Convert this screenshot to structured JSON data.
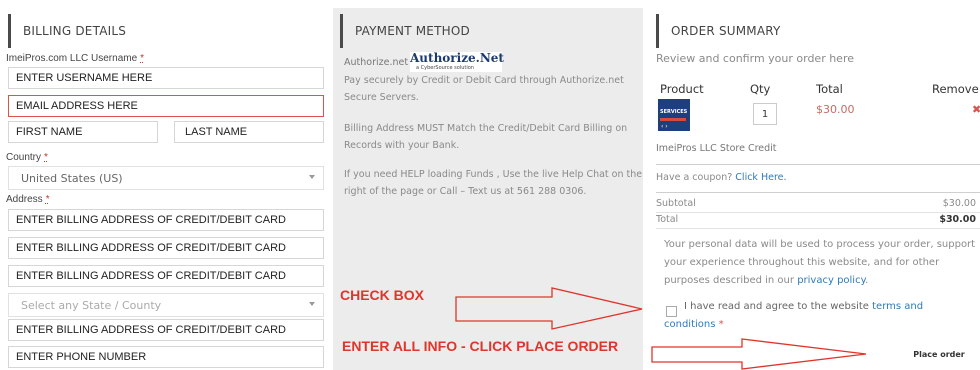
{
  "billing": {
    "header": "BILLING DETAILS",
    "username_label": "ImeiPros.com LLC Username",
    "required_mark": "*",
    "username_value": "ENTER USERNAME HERE",
    "email_value": "EMAIL ADDRESS HERE",
    "first_name_value": "FIRST NAME",
    "last_name_value": "LAST NAME",
    "country_label": "Country",
    "country_value": "United States (US)",
    "address_label": "Address",
    "address_line1": "ENTER BILLING ADDRESS OF CREDIT/DEBIT CARD",
    "address_line2": "ENTER BILLING ADDRESS OF CREDIT/DEBIT CARD",
    "city_value": "ENTER BILLING ADDRESS OF CREDIT/DEBIT CARD",
    "state_placeholder": "Select any State / County",
    "zip_value": "ENTER BILLING ADDRESS OF CREDIT/DEBIT CARD",
    "phone_value": "ENTER PHONE NUMBER"
  },
  "payment": {
    "header": "PAYMENT METHOD",
    "method_name": "Authorize.net",
    "logo_text": "Authorize.Net",
    "logo_sub": "a CyberSource solution",
    "desc1": "Pay securely by Credit or Debit Card through Authorize.net Secure Servers.",
    "desc2": "Billing Address MUST Match the Credit/Debit Card Billing on Records with your Bank.",
    "desc3": "If you need HELP loading Funds , Use the live Help Chat on the right of the page or Call – Text us at 561 288 0306."
  },
  "annotations": {
    "check_box": "CHECK BOX",
    "enter_info": "ENTER ALL INFO - CLICK PLACE ORDER",
    "arrow_color": "#e0352b"
  },
  "summary": {
    "header": "ORDER SUMMARY",
    "subtitle": "Review and confirm your order here",
    "col_product": "Product",
    "col_qty": "Qty",
    "col_total": "Total",
    "col_remove": "Remove",
    "item_thumb_text": "SERVICES",
    "item_qty": "1",
    "item_price": "$30.00",
    "item_name": "ImeiPros LLC Store Credit",
    "coupon_prefix": "Have a coupon?",
    "coupon_link": "Click Here.",
    "subtotal_label": "Subtotal",
    "subtotal_value": "$30.00",
    "total_label": "Total",
    "total_value": "$30.00",
    "policy_text": "Your personal data will be used to process your order, support your experience throughout this website, and for other purposes described in our",
    "policy_link": "privacy policy",
    "agree_text": "I have read and agree to the website",
    "terms_link": "terms and conditions",
    "place_order": "Place order"
  }
}
